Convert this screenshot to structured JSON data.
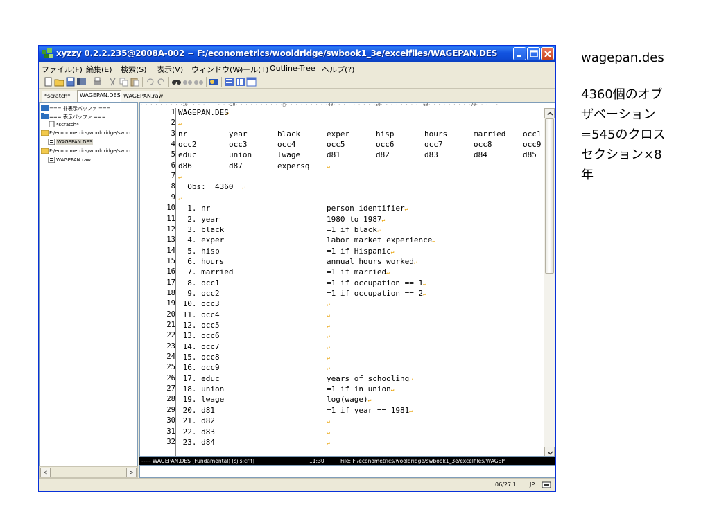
{
  "window": {
    "title": "xyzzy 0.2.2.235@2008A-002 − F:/econometrics/wooldridge/swbook1_3e/excelfiles/WAGEPAN.DES"
  },
  "menu": [
    "ファイル(F)",
    "編集(E)",
    "検索(S)",
    "表示(V)",
    "ウィンドウ(W)",
    "ツール(T)",
    "Outline-Tree",
    "ヘルプ(?)"
  ],
  "tabs": [
    "*scratch*",
    "WAGEPAN.DES",
    "WAGEPAN.raw"
  ],
  "sidebar": {
    "items": [
      {
        "label": "=== 非表示バッファ ===",
        "icon": "folder-icon"
      },
      {
        "label": "=== 表示バッファ ===",
        "icon": "folder-icon"
      },
      {
        "label": "*scratch*",
        "icon": "document-icon"
      },
      {
        "label": "F:/econometrics/wooldridge/swbo",
        "icon": "folder-icon"
      },
      {
        "label": "WAGEPAN.DES",
        "icon": "text-file-icon"
      },
      {
        "label": "F:/econometrics/wooldridge/swbo",
        "icon": "folder-icon"
      },
      {
        "label": "WAGEPAN.raw",
        "icon": "text-file-icon"
      }
    ],
    "scroll_left": "<",
    "scroll_right": ">"
  },
  "editor": {
    "ruler": "· · · · · · · · ·10· · · · · · · · ·20· · · · · · · · · ·□· · · · · · · · ·40· · · · · · · · ·50· · · · · · · · ·60· · · · · · · · ·70· · · · ·",
    "line_numbers": [
      "1",
      "2",
      "3",
      "4",
      "5",
      "6",
      "7",
      "8",
      "9",
      "10",
      "11",
      "12",
      "13",
      "14",
      "15",
      "16",
      "17",
      "18",
      "19",
      "20",
      "21",
      "22",
      "23",
      "24",
      "25",
      "26",
      "27",
      "28",
      "29",
      "30",
      "31",
      "32"
    ],
    "lines": [
      [
        "WAGEPAN.DES"
      ],
      [
        ""
      ],
      [
        "nr",
        "year",
        "black",
        "exper",
        "hisp",
        "hours",
        "married",
        "occ1"
      ],
      [
        "occ2",
        "occ3",
        "occ4",
        "occ5",
        "occ6",
        "occ7",
        "occ8",
        "occ9"
      ],
      [
        "educ",
        "union",
        "lwage",
        "d81",
        "d82",
        "d83",
        "d84",
        "d85"
      ],
      [
        "d86",
        "d87",
        "expersq"
      ],
      [
        ""
      ],
      [
        "  Obs:  4360"
      ],
      [
        ""
      ],
      [
        "  1. nr",
        "person identifier"
      ],
      [
        "  2. year",
        "1980 to 1987"
      ],
      [
        "  3. black",
        "=1 if black"
      ],
      [
        "  4. exper",
        "labor market experience"
      ],
      [
        "  5. hisp",
        "=1 if Hispanic"
      ],
      [
        "  6. hours",
        "annual hours worked"
      ],
      [
        "  7. married",
        "=1 if married"
      ],
      [
        "  8. occ1",
        "=1 if occupation == 1"
      ],
      [
        "  9. occ2",
        "=1 if occupation == 2"
      ],
      [
        " 10. occ3",
        ""
      ],
      [
        " 11. occ4",
        ""
      ],
      [
        " 12. occ5",
        ""
      ],
      [
        " 13. occ6",
        ""
      ],
      [
        " 14. occ7",
        ""
      ],
      [
        " 15. occ8",
        ""
      ],
      [
        " 16. occ9",
        ""
      ],
      [
        " 17. educ",
        "years of schooling"
      ],
      [
        " 18. union",
        "=1 if in union"
      ],
      [
        " 19. lwage",
        "log(wage)"
      ],
      [
        " 20. d81",
        "=1 if year == 1981"
      ],
      [
        " 21. d82",
        ""
      ],
      [
        " 22. d83",
        ""
      ],
      [
        " 23. d84",
        ""
      ]
    ],
    "newline_marker": "↵"
  },
  "status": {
    "mode": "----- WAGEPAN.DES (Fundamental) [sjis:crlf]",
    "time": "11:30",
    "file": "File: F:/econometrics/wooldridge/swbook1_3e/excelfiles/WAGEP"
  },
  "bottom": {
    "date": "06/27 1",
    "ime": "JP"
  },
  "notes": {
    "file": "wagepan.des",
    "description": "4360個のオブ\nザベーション\n=545のクロス\nセクション×8\n年"
  },
  "colors": {
    "titlebar": "#0e4bd5",
    "newline_marker": "#e8a000",
    "status_bg": "#000000"
  }
}
